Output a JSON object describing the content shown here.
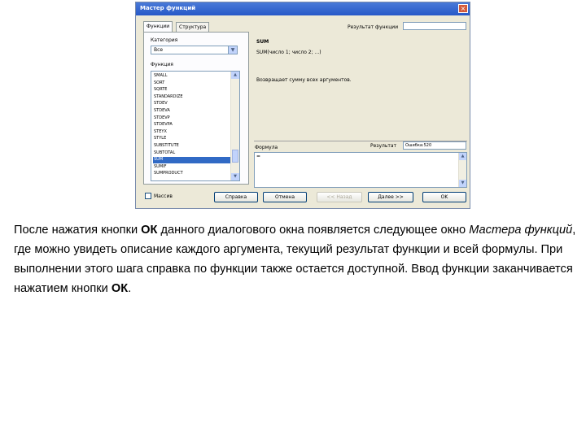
{
  "dialog": {
    "title": "Мастер функций",
    "close_icon": "×",
    "tabs": [
      "Функции",
      "Структура"
    ],
    "category_label": "Категория",
    "category_value": "Все",
    "function_label": "Функция",
    "functions": [
      "SMALL",
      "SORT",
      "SQRTE",
      "STANDARDIZE",
      "STDEV",
      "STDEVA",
      "STDEVP",
      "STDEVPA",
      "STEYX",
      "STYLE",
      "SUBSTITUTE",
      "SUBTOTAL",
      "SUM",
      "SUMIF",
      "SUMPRODUCT"
    ],
    "selected_function": "SUM",
    "function_result_label": "Результат функции",
    "function_name": "SUM",
    "function_syntax": "SUM(число 1; число 2; ...)",
    "function_description": "Возвращает сумму всех аргументов.",
    "formula_label": "Формула",
    "result_label": "Результат",
    "result_value": "Ошибка:520",
    "formula_value": "=",
    "array_label": "Массив",
    "buttons": {
      "help": "Справка",
      "cancel": "Отмена",
      "back": "<< Назад",
      "next": "Далее >>",
      "ok": "OK"
    },
    "scroll_up_icon": "▲",
    "scroll_down_icon": "▼",
    "dropdown_icon": "▼"
  },
  "caption": {
    "part1": "После нажатия кнопки ",
    "ok_bold": "ОК",
    "part2": " данного диалогового окна появляется следующее окно ",
    "wizard_italic": "Мастера функций",
    "part3": ", где можно увидеть описание каждого аргумента, текущий результат функции и всей формулы. При выполнении этого шага справка по функции также остается доступной. Ввод функции заканчивается нажатием кнопки ",
    "ok_end": "ОК",
    "part4": "."
  }
}
